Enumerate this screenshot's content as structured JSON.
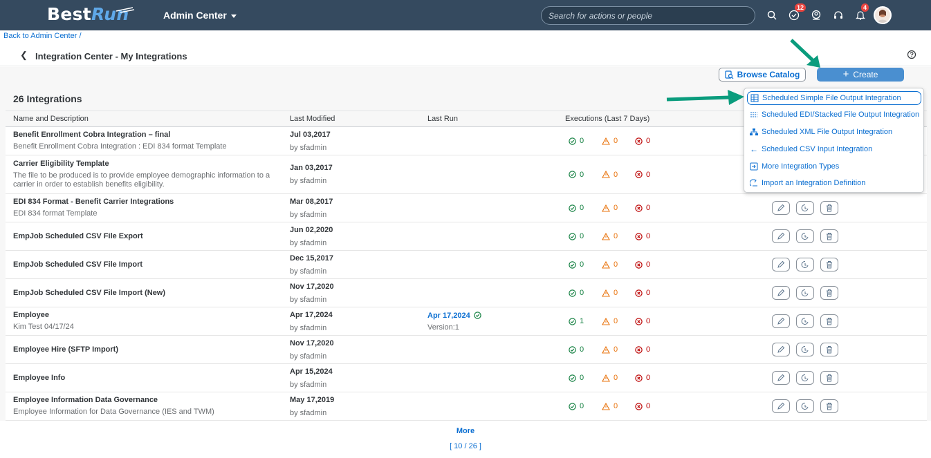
{
  "shell": {
    "logo_a": "Best",
    "logo_b": "Run",
    "module": "Admin Center",
    "search_placeholder": "Search for actions or people",
    "todo_badge": "12",
    "notif_badge": "4"
  },
  "breadcrumb": "Back to Admin Center /",
  "page_title": "Integration Center - My Integrations",
  "buttons": {
    "browse": "Browse Catalog",
    "create": "Create"
  },
  "count_title": "26 Integrations",
  "columns": [
    "Name and Description",
    "Last Modified",
    "Last Run",
    "Executions (Last 7 Days)"
  ],
  "rows": [
    {
      "name": "Benefit Enrollment Cobra Integration – final",
      "desc": "Benefit Enrollment Cobra Integration : EDI 834 format Template",
      "modified": "Jul 03,2017",
      "by": "by sfadmin",
      "last_run": "",
      "version": "",
      "ok": "0",
      "warn": "0",
      "err": "0"
    },
    {
      "name": "Carrier Eligibility Template",
      "desc": "The file to be produced is to provide employee demographic information to a carrier in order to establish benefits eligibility.",
      "modified": "Jan 03,2017",
      "by": "by sfadmin",
      "last_run": "",
      "version": "",
      "ok": "0",
      "warn": "0",
      "err": "0"
    },
    {
      "name": "EDI 834 Format - Benefit Carrier Integrations",
      "desc": "EDI 834 format Template",
      "modified": "Mar 08,2017",
      "by": "by sfadmin",
      "last_run": "",
      "version": "",
      "ok": "0",
      "warn": "0",
      "err": "0"
    },
    {
      "name": "EmpJob Scheduled CSV File Export",
      "desc": "",
      "modified": "Jun 02,2020",
      "by": "by sfadmin",
      "last_run": "",
      "version": "",
      "ok": "0",
      "warn": "0",
      "err": "0"
    },
    {
      "name": "EmpJob Scheduled CSV File Import",
      "desc": "",
      "modified": "Dec 15,2017",
      "by": "by sfadmin",
      "last_run": "",
      "version": "",
      "ok": "0",
      "warn": "0",
      "err": "0"
    },
    {
      "name": "EmpJob Scheduled CSV File Import (New)",
      "desc": "",
      "modified": "Nov 17,2020",
      "by": "by sfadmin",
      "last_run": "",
      "version": "",
      "ok": "0",
      "warn": "0",
      "err": "0"
    },
    {
      "name": "Employee",
      "desc": "Kim Test 04/17/24",
      "modified": "Apr 17,2024",
      "by": "by sfadmin",
      "last_run": "Apr 17,2024",
      "version": "Version:1",
      "ok": "1",
      "warn": "0",
      "err": "0"
    },
    {
      "name": "Employee Hire (SFTP Import)",
      "desc": "",
      "modified": "Nov 17,2020",
      "by": "by sfadmin",
      "last_run": "",
      "version": "",
      "ok": "0",
      "warn": "0",
      "err": "0"
    },
    {
      "name": "Employee Info",
      "desc": "",
      "modified": "Apr 15,2024",
      "by": "by sfadmin",
      "last_run": "",
      "version": "",
      "ok": "0",
      "warn": "0",
      "err": "0"
    },
    {
      "name": "Employee Information Data Governance",
      "desc": "Employee Information for Data Governance (IES and TWM)",
      "modified": "May 17,2019",
      "by": "by sfadmin",
      "last_run": "",
      "version": "",
      "ok": "0",
      "warn": "0",
      "err": "0"
    }
  ],
  "more": "More",
  "pagination": "[ 10 / 26 ]",
  "create_menu": [
    {
      "label": "Scheduled Simple File Output Integration",
      "icon": "table-icon"
    },
    {
      "label": "Scheduled EDI/Stacked File Output Integration",
      "icon": "stacked-icon"
    },
    {
      "label": "Scheduled XML File Output Integration",
      "icon": "hierarchy-icon"
    },
    {
      "label": "Scheduled CSV Input Integration",
      "icon": "arrow-left-icon"
    },
    {
      "label": "More Integration Types",
      "icon": "enter-icon"
    },
    {
      "label": "Import an Integration Definition",
      "icon": "import-icon"
    }
  ],
  "colors": {
    "shell": "#354a5f",
    "link": "#0a6ed1",
    "create": "#4a8fd0",
    "success": "#107e3e",
    "warning": "#e9730c",
    "error": "#bb0000",
    "annotation_arrow": "#0a9c7d"
  }
}
